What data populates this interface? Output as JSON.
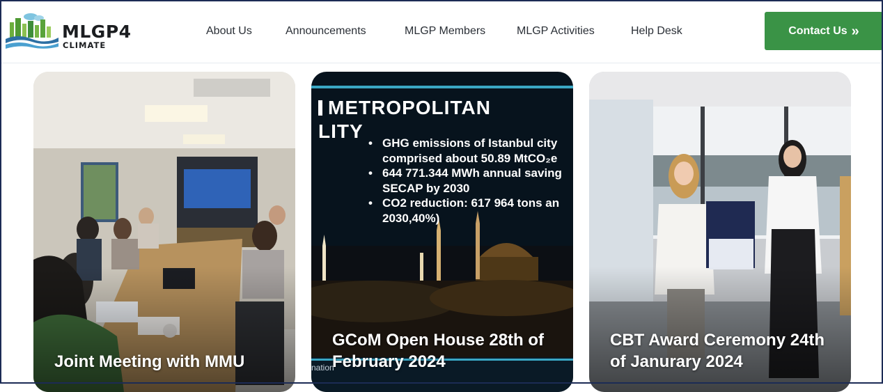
{
  "brand": {
    "name": "MLGP4",
    "tagline": "CLIMATE"
  },
  "nav": {
    "items": [
      {
        "label": "About Us"
      },
      {
        "label": "Announcements"
      },
      {
        "label": "MLGP Members"
      },
      {
        "label": "MLGP Activities"
      },
      {
        "label": "Help Desk"
      }
    ],
    "contact_label": "Contact Us",
    "contact_icon": "double-chevron-right-icon"
  },
  "colors": {
    "accent": "#3a9346",
    "frame": "#1c2b55"
  },
  "cards": [
    {
      "title": "Joint Meeting with MMU"
    },
    {
      "title": "GCoM Open House 28th of February 2024",
      "slide": {
        "heading_line1": "METROPOLITAN",
        "heading_line2": "LITY",
        "bullets": [
          {
            "first": "GHG emissions of Istanbul city",
            "second": "comprised about 50.89 MtCO₂e"
          },
          {
            "first": "644 771.344 MWh annual saving",
            "second": "SECAP by 2030"
          },
          {
            "first": "CO2 reduction: 617 964 tons an",
            "second": "2030,40%)"
          }
        ],
        "caption_fragment": "nation"
      }
    },
    {
      "title": "CBT Award Ceremony 24th of Janurary 2024"
    }
  ]
}
